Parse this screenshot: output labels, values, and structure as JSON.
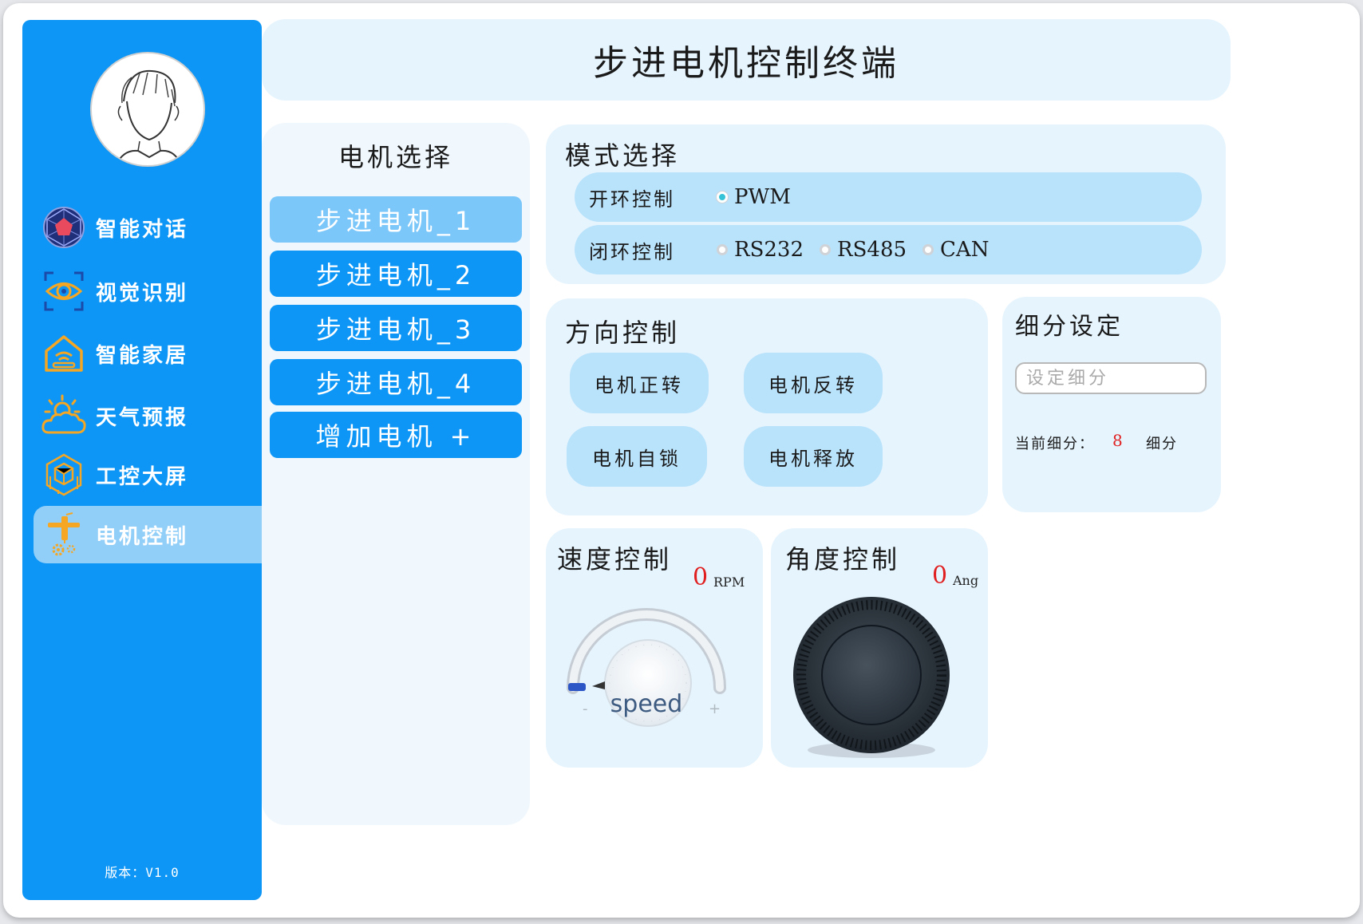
{
  "app": {
    "title": "步进电机控制终端",
    "version": "版本：V1.0"
  },
  "sidebar": {
    "items": [
      {
        "label": "智能对话",
        "icon": "sphere-icon",
        "active": false
      },
      {
        "label": "视觉识别",
        "icon": "eye-icon",
        "active": false
      },
      {
        "label": "智能家居",
        "icon": "smart-home-icon",
        "active": false
      },
      {
        "label": "天气预报",
        "icon": "weather-icon",
        "active": false
      },
      {
        "label": "工控大屏",
        "icon": "industrial-icon",
        "active": false
      },
      {
        "label": "电机控制",
        "icon": "motor-gear-icon",
        "active": true
      }
    ]
  },
  "motor_select": {
    "title": "电机选择",
    "motors": [
      "步进电机_1",
      "步进电机_2",
      "步进电机_3",
      "步进电机_4"
    ],
    "selected_index": 0,
    "add_label": "增加电机 +"
  },
  "mode": {
    "title": "模式选择",
    "open_loop": {
      "label": "开环控制",
      "options": [
        "PWM"
      ],
      "selected": "PWM"
    },
    "closed_loop": {
      "label": "闭环控制",
      "options": [
        "RS232",
        "RS485",
        "CAN"
      ],
      "selected": null
    }
  },
  "direction": {
    "title": "方向控制",
    "buttons": [
      "电机正转",
      "电机反转",
      "电机自锁",
      "电机释放"
    ]
  },
  "subdivision": {
    "title": "细分设定",
    "placeholder": "设定细分",
    "current_label": "当前细分：",
    "current_value": "8",
    "unit": "细分"
  },
  "speed": {
    "title": "速度控制",
    "value": "0",
    "unit": "RPM",
    "dial_label": "speed",
    "minus": "-",
    "plus": "+"
  },
  "angle": {
    "title": "角度控制",
    "value": "0",
    "unit": "Ang"
  },
  "colors": {
    "accent": "#0d96f5",
    "panel": "#e6f4fe",
    "pill": "#b9e2fb",
    "value_red": "#e02020"
  }
}
